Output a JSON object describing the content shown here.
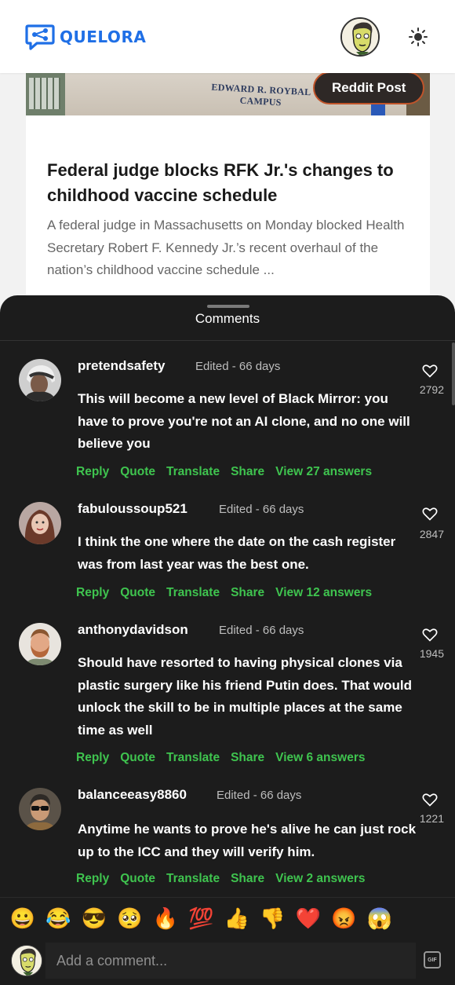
{
  "app": {
    "name": "QUELORA",
    "brand_color": "#1f6fe6"
  },
  "header": {
    "avatar_icon": "user-avatar",
    "theme_toggle_icon": "sun-icon"
  },
  "article": {
    "badge": "Reddit Post",
    "sign_line1": "EDWARD R. ROYBAL",
    "sign_line2": "CAMPUS",
    "title": "Federal judge blocks RFK Jr.'s changes to childhood vaccine schedule",
    "description": "A federal judge in Massachusetts on Monday blocked Health Secretary Robert F. Kennedy Jr.’s recent overhaul of the nation’s childhood vaccine schedule ..."
  },
  "comments_sheet": {
    "title": "Comments",
    "items": [
      {
        "username": "pretendsafety",
        "meta": "Edited - 66 days",
        "text": "This will become a new level of Black Mirror: you have to prove you're not an AI clone, and no one will believe you",
        "likes": "2792",
        "actions": {
          "reply": "Reply",
          "quote": "Quote",
          "translate": "Translate",
          "share": "Share",
          "view": "View 27 answers"
        }
      },
      {
        "username": "fabuloussoup521",
        "meta": "Edited - 66 days",
        "text": "I think the one where the date on the cash register was from last year was the best one.",
        "likes": "2847",
        "actions": {
          "reply": "Reply",
          "quote": "Quote",
          "translate": "Translate",
          "share": "Share",
          "view": "View 12 answers"
        }
      },
      {
        "username": "anthonydavidson",
        "meta": "Edited - 66 days",
        "text": "Should have resorted to having physical clones via plastic surgery like his friend Putin does. That would unlock the skill to be in multiple places at the same time as well",
        "likes": "1945",
        "actions": {
          "reply": "Reply",
          "quote": "Quote",
          "translate": "Translate",
          "share": "Share",
          "view": "View 6 answers"
        }
      },
      {
        "username": "balanceeasy8860",
        "meta": "Edited - 66 days",
        "text": "Anytime he wants to prove he's alive he can just rock up to the ICC and they will verify him.",
        "likes": "1221",
        "actions": {
          "reply": "Reply",
          "quote": "Quote",
          "translate": "Translate",
          "share": "Share",
          "view": "View 2 answers"
        }
      }
    ]
  },
  "reactions": [
    "😀",
    "😂",
    "😎",
    "🥺",
    "🔥",
    "💯",
    "👍",
    "👎",
    "❤️",
    "😡",
    "😱"
  ],
  "composer": {
    "placeholder": "Add a comment...",
    "gif_label": "GIF"
  },
  "colors": {
    "action_green": "#3fc44f",
    "sheet_bg": "#1c1c1c",
    "reddit_border": "#c0542a"
  }
}
